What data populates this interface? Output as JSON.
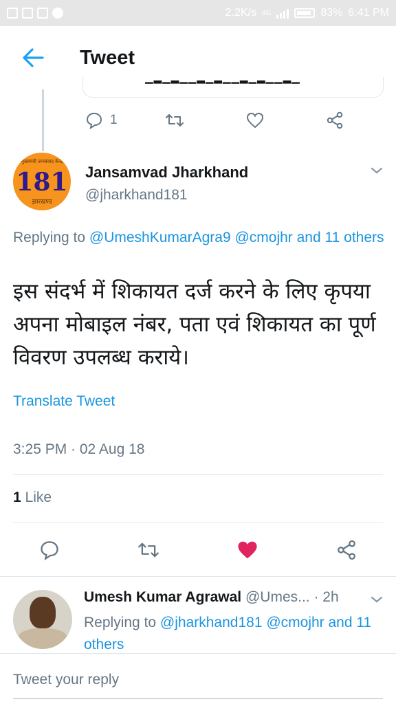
{
  "status_bar": {
    "network_speed": "2.2K/s",
    "network_type": "4G",
    "battery": "83%",
    "time": "6:41 PM"
  },
  "header": {
    "back_icon": "arrow-left-icon",
    "title": "Tweet"
  },
  "previous_tweet": {
    "reply_count": "1",
    "icons": [
      "reply-icon",
      "retweet-icon",
      "like-icon",
      "share-icon"
    ]
  },
  "tweet": {
    "author_name": "Jansamvad Jharkhand",
    "author_handle": "@jharkhand181",
    "avatar": {
      "number": "181",
      "top_text": "मुख्यमंत्री जनसंवाद केन्द्र",
      "bottom_text": "झारखण्ड",
      "bg_color": "#f7941d"
    },
    "replying_to_prefix": "Replying to ",
    "replying_to_mentions": "@UmeshKumarAgra9 @cmojhr and 11 others",
    "text": "इस संदर्भ में शिकायत दर्ज करने के लिए कृपया अपना मोबाइल नंबर, पता एवं शिकायत का पूर्ण विवरण उपलब्ध कराये।",
    "translate_label": "Translate Tweet",
    "timestamp": "3:25 PM · 02 Aug 18",
    "like_count": "1",
    "like_label": " Like",
    "liked": true,
    "accent_color": "#1b95e0",
    "like_color": "#e0245e"
  },
  "reply_tweet": {
    "author_name": "Umesh Kumar Agrawal",
    "author_handle_truncated": "@Umes...",
    "time_ago": "· 2h",
    "replying_to_prefix": "Replying to ",
    "replying_to_mentions": "@jharkhand181 @cmojhr and 11 others"
  },
  "compose": {
    "placeholder": "Tweet your reply"
  }
}
